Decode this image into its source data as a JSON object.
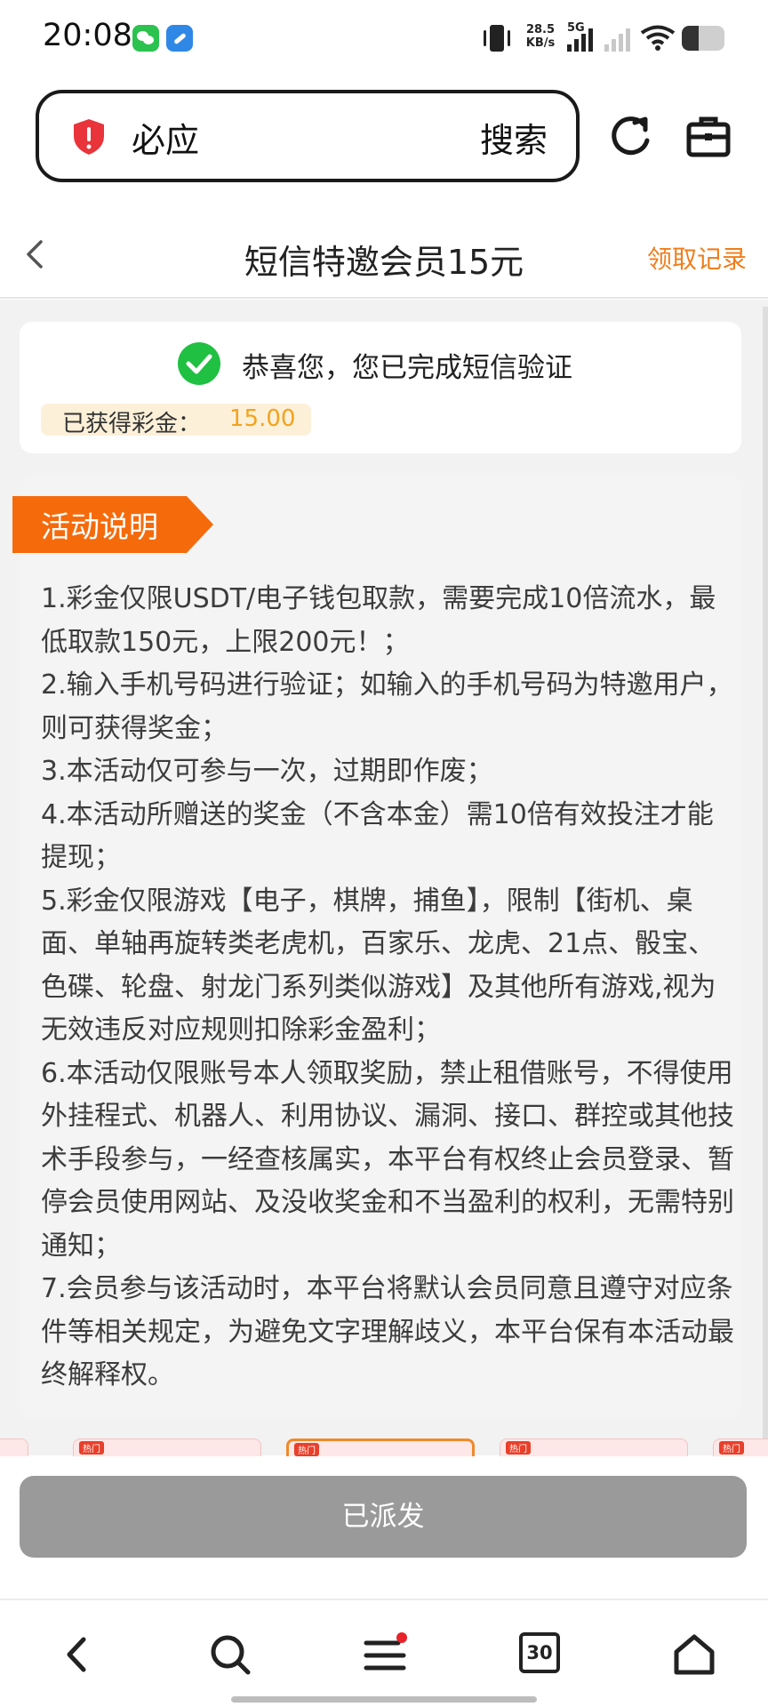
{
  "status_bar": {
    "time": "20:08",
    "net_speed": "28.5",
    "net_speed_unit": "KB/s",
    "network_type": "5G",
    "battery_level": 0.4
  },
  "browser": {
    "search_query": "必应",
    "search_button": "搜索",
    "icons": [
      "shield-icon",
      "reload-icon",
      "toolbox-icon"
    ]
  },
  "page": {
    "title": "短信特邀会员15元",
    "records_link": "领取记录"
  },
  "verify_card": {
    "message": "恭喜您，您已完成短信验证",
    "bonus_label": "已获得彩金：",
    "bonus_value": "15.00"
  },
  "rules": {
    "tag": "活动说明",
    "items": [
      "1.彩金仅限USDT/电子钱包取款，需要完成10倍流水，最低取款150元，上限200元！；",
      "2.输入手机号码进行验证；如输入的手机号码为特邀用户，则可获得奖金；",
      "3.本活动仅可参与一次，过期即作废；",
      "4.本活动所赠送的奖金（不含本金）需10倍有效投注才能提现；",
      "5.彩金仅限游戏【电子，棋牌，捕鱼】，限制【街机、桌面、单轴再旋转类老虎机，百家乐、龙虎、21点、骰宝、色碟、轮盘、射龙门系列类似游戏】及其他所有游戏,视为无效违反对应规则扣除彩金盈利；",
      "6.本活动仅限账号本人领取奖励，禁止租借账号，不得使用外挂程式、机器人、利用协议、漏洞、接口、群控或其他技术手段参与，一经查核属实，本平台有权终止会员登录、暂停会员使用网站、及没收奖金和不当盈利的权利，无需特别通知；",
      "7.会员参与该活动时，本平台将默认会员同意且遵守对应条件等相关规定，为避免文字理解歧义，本平台保有本活动最终解释权。"
    ]
  },
  "thumb_badges": [
    "热门",
    "热门",
    "热门",
    "热门"
  ],
  "dispatch_button": "已派发",
  "bottom_nav": {
    "tab_count": "30",
    "icons": [
      "back-icon",
      "search-icon",
      "menu-icon",
      "tabs-icon",
      "home-icon"
    ]
  },
  "colors": {
    "accent_orange": "#f07d1a",
    "tag_orange": "#f56b0c",
    "success_green": "#20c043",
    "bonus_gold": "#f3a21e",
    "disabled_gray": "#9a9a9a"
  }
}
